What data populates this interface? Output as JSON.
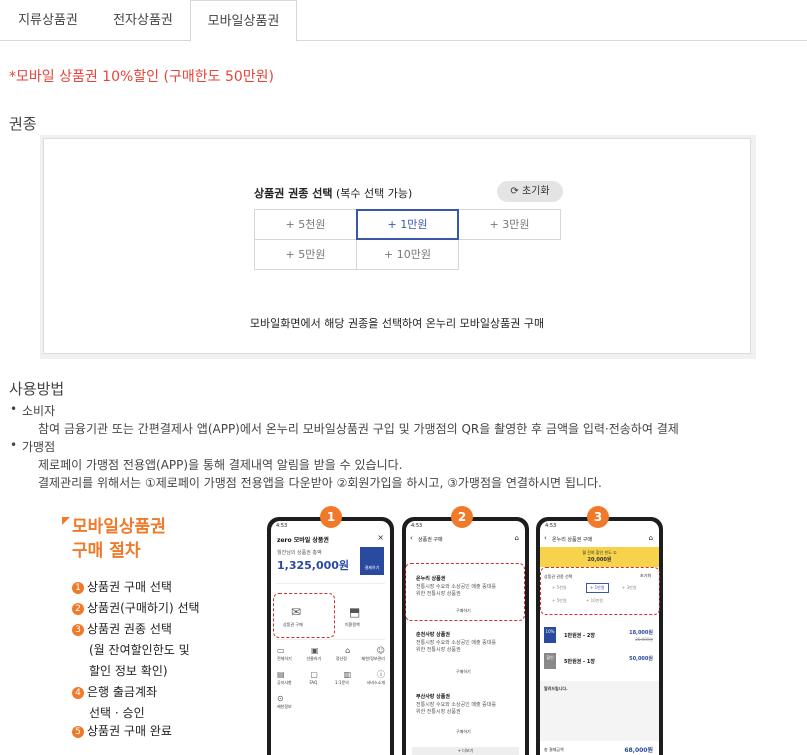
{
  "tabs": [
    "지류상품권",
    "전자상품권",
    "모바일상품권"
  ],
  "promo": "*모바일 상품권 10%할인 (구매한도 50만원)",
  "section_denomination": "권종",
  "panel": {
    "head_bold": "상품권 권종 선택",
    "head_rest": " (복수 선택 가능)",
    "reset": "초기화",
    "options": [
      "+ 5천원",
      "+ 1만원",
      "+ 3만원",
      "+ 5만원",
      "+ 10만원"
    ],
    "selected": "+ 1만원",
    "footer": "모바일화면에서 해당 권종을 선택하여 온누리 모바일상품권 구매"
  },
  "usage": {
    "title": "사용방법",
    "consumer_label": "소비자",
    "consumer_text": "참여 금융기관 또는 간편결제사 앱(APP)에서 온누리 모바일상품권 구입 및 가맹점의 QR을 촬영한 후 금액을 입력·전송하여 결제",
    "merchant_label": "가맹점",
    "merchant_text1": "제로페이 가맹점 전용앱(APP)을 통해 결제내역 알림을 받을 수 있습니다.",
    "merchant_text2": "결제관리를 위해서는 ①제로페이 가맹점 전용앱을 다운받아 ②회원가입을 하시고, ③가맹점을 연결하시면 됩니다."
  },
  "procedure": {
    "title1": "모바일상품권",
    "title2": "구매 절차",
    "steps": [
      {
        "n": "1",
        "text": "상품권 구매 선택"
      },
      {
        "n": "2",
        "text": "상품권(구매하기) 선택"
      },
      {
        "n": "3",
        "text": "상품권 권종 선택"
      },
      {
        "n": "",
        "text": "(월 잔여할인한도 및"
      },
      {
        "n": "",
        "text": "할인 정보 확인)"
      },
      {
        "n": "4",
        "text": "은행 출금계좌"
      },
      {
        "n": "",
        "text": "선택 · 승인"
      },
      {
        "n": "5",
        "text": "상품권 구매 완료"
      }
    ],
    "badges": [
      "1",
      "2",
      "3"
    ]
  },
  "phone1": {
    "time": "4:53",
    "app": "zero 모바일 상품권",
    "balance_label": "월잔님의 상품권 총액",
    "balance": "1,325,000원",
    "pay": "결제하기",
    "buy": "상품권 구매",
    "gift": "미환원액",
    "menu": [
      "전체하기",
      "선물하기",
      "정산정",
      "제한/정보관리",
      "공지사항",
      "FAQ",
      "1:1문의",
      "서비스소개",
      "제한정보"
    ]
  },
  "phone2": {
    "time": "4:53",
    "title": "상품권 구매",
    "items": [
      "온누리 상품권",
      "춘천사랑 상품권",
      "부산사랑 상품권"
    ],
    "desc": "전통시장 수요와 소상공인 매출 증대를 위한 전통시장 상품권",
    "buy": "구매하기",
    "more": "+ 더보기"
  },
  "phone3": {
    "time": "4:53",
    "title": "온누리 상품권 구매",
    "limit_label": "월 잔여 할인 한도 ①",
    "limit": "20,000원",
    "select_label": "상품권 권종 선택",
    "reset": "초기화",
    "opts": [
      "+ 5천원",
      "+ 1만원",
      "+ 3만원",
      "+ 5만원",
      "+ 10만원"
    ],
    "row1_badge": "10%",
    "row1_name": "1만원권 - 2장",
    "row1_price": "18,000원",
    "row1_orig": "20,000원",
    "row2_badge": "할인",
    "row2_name": "5만원권 - 1장",
    "row2_price": "50,000원",
    "notice": "알려드립니다.",
    "total_label": "총 결제금액",
    "total": "68,000원"
  },
  "colors": {
    "accent": "#f07a2a",
    "promo": "#e8433a",
    "selected": "#3a56a8",
    "phone3_header": "#f6d34a"
  }
}
